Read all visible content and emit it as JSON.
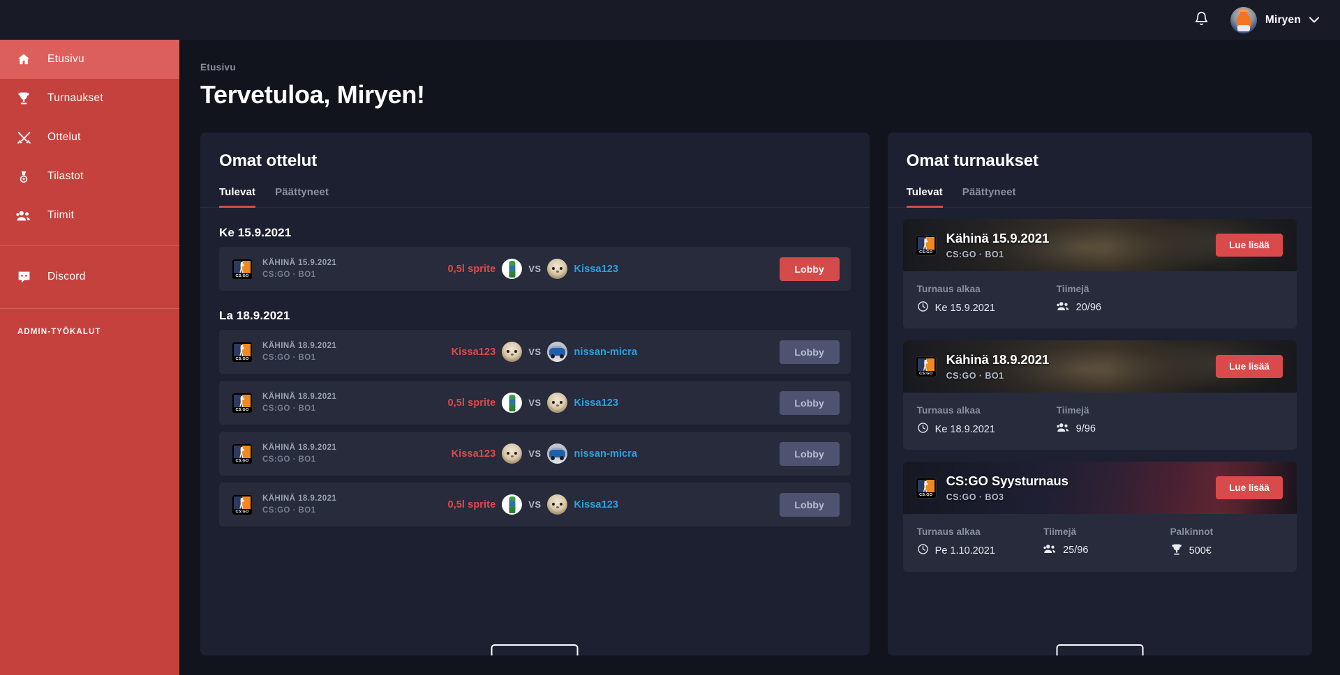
{
  "topbar": {
    "bell_icon": "bell-icon",
    "username": "Miryen",
    "chevron_icon": "chevron-down-icon"
  },
  "sidebar": {
    "items": [
      {
        "label": "Etusivu",
        "icon": "home-icon",
        "active": true
      },
      {
        "label": "Turnaukset",
        "icon": "trophy-icon",
        "active": false
      },
      {
        "label": "Ottelut",
        "icon": "swords-icon",
        "active": false
      },
      {
        "label": "Tilastot",
        "icon": "medal-icon",
        "active": false
      },
      {
        "label": "Tiimit",
        "icon": "people-icon",
        "active": false
      }
    ],
    "discord": {
      "label": "Discord",
      "icon": "discord-icon"
    },
    "admin_label": "ADMIN-TYÖKALUT",
    "bg_color": "#c4413d",
    "active_color": "#dc5f5b"
  },
  "main": {
    "breadcrumb": "Etusivu",
    "page_title": "Tervetuloa, Miryen!"
  },
  "matches_card": {
    "title": "Omat ottelut",
    "tabs": [
      {
        "label": "Tulevat",
        "active": true
      },
      {
        "label": "Päättyneet",
        "active": false
      }
    ],
    "groups": [
      {
        "day": "Ke 15.9.2021",
        "rows": [
          {
            "name": "KÄHINÄ 15.9.2021",
            "sub": "CS:GO · BO1",
            "team_a": "0,5l sprite",
            "team_a_avatar": "sprite",
            "team_b": "Kissa123",
            "team_b_avatar": "cat",
            "vs": "VS",
            "button": "Lobby",
            "button_state": "primary"
          }
        ]
      },
      {
        "day": "La 18.9.2021",
        "rows": [
          {
            "name": "KÄHINÄ 18.9.2021",
            "sub": "CS:GO · BO1",
            "team_a": "Kissa123",
            "team_a_avatar": "cat",
            "team_b": "nissan-micra",
            "team_b_avatar": "car",
            "vs": "VS",
            "button": "Lobby",
            "button_state": "disabled"
          },
          {
            "name": "KÄHINÄ 18.9.2021",
            "sub": "CS:GO · BO1",
            "team_a": "0,5l sprite",
            "team_a_avatar": "sprite",
            "team_b": "Kissa123",
            "team_b_avatar": "cat",
            "vs": "VS",
            "button": "Lobby",
            "button_state": "disabled"
          },
          {
            "name": "KÄHINÄ 18.9.2021",
            "sub": "CS:GO · BO1",
            "team_a": "Kissa123",
            "team_a_avatar": "cat",
            "team_b": "nissan-micra",
            "team_b_avatar": "car",
            "vs": "VS",
            "button": "Lobby",
            "button_state": "disabled"
          },
          {
            "name": "KÄHINÄ 18.9.2021",
            "sub": "CS:GO · BO1",
            "team_a": "0,5l sprite",
            "team_a_avatar": "sprite",
            "team_b": "Kissa123",
            "team_b_avatar": "cat",
            "vs": "VS",
            "button": "Lobby",
            "button_state": "disabled"
          }
        ]
      }
    ]
  },
  "tournaments_card": {
    "title": "Omat turnaukset",
    "tabs": [
      {
        "label": "Tulevat",
        "active": true
      },
      {
        "label": "Päättyneet",
        "active": false
      }
    ],
    "items": [
      {
        "name": "Kähinä 15.9.2021",
        "sub": "CS:GO · BO1",
        "button": "Lue lisää",
        "banner": "soldier",
        "stats": [
          {
            "label": "Turnaus alkaa",
            "value": "Ke 15.9.2021",
            "icon": "clock-icon"
          },
          {
            "label": "Tiimejä",
            "value": "20/96",
            "icon": "people-icon"
          }
        ]
      },
      {
        "name": "Kähinä 18.9.2021",
        "sub": "CS:GO · BO1",
        "button": "Lue lisää",
        "banner": "soldier",
        "stats": [
          {
            "label": "Turnaus alkaa",
            "value": "Ke 18.9.2021",
            "icon": "clock-icon"
          },
          {
            "label": "Tiimejä",
            "value": "9/96",
            "icon": "people-icon"
          }
        ]
      },
      {
        "name": "CS:GO Syysturnaus",
        "sub": "CS:GO · BO3",
        "button": "Lue lisää",
        "banner": "autumn",
        "stats": [
          {
            "label": "Turnaus alkaa",
            "value": "Pe 1.10.2021",
            "icon": "clock-icon"
          },
          {
            "label": "Tiimejä",
            "value": "25/96",
            "icon": "people-icon"
          },
          {
            "label": "Palkinnot",
            "value": "500€",
            "icon": "trophy-icon"
          }
        ]
      }
    ]
  },
  "colors": {
    "page_bg": "#12141d",
    "card_bg": "#1d2030",
    "row_bg": "#272b3b",
    "accent_red": "#d94a4a",
    "team_red": "#e04a4a",
    "team_blue": "#2f9fe0",
    "muted": "#8b90a0"
  }
}
